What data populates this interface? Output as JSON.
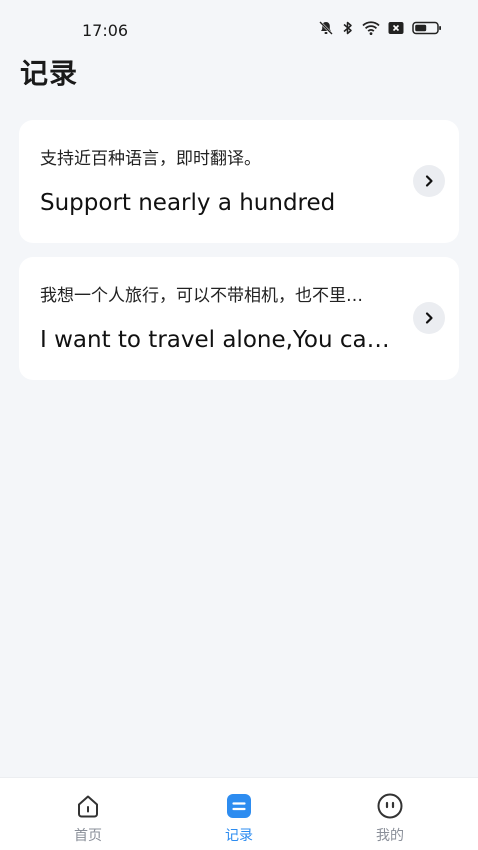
{
  "status_bar": {
    "time": "17:06",
    "icons": [
      "mute-icon",
      "bluetooth-icon",
      "wifi-icon",
      "sim-x-icon",
      "battery-icon"
    ]
  },
  "header": {
    "title": "记录"
  },
  "records": [
    {
      "source": "支持近百种语言，即时翻译。",
      "target": "Support nearly a hundred"
    },
    {
      "source": "我想一个人旅行，可以不带相机，也不里…",
      "target": "I want to travel alone,You ca…"
    }
  ],
  "tab_bar": {
    "tabs": [
      {
        "label": "首页",
        "icon": "home-icon",
        "active": false
      },
      {
        "label": "记录",
        "icon": "record-icon",
        "active": true
      },
      {
        "label": "我的",
        "icon": "profile-icon",
        "active": false
      }
    ]
  },
  "colors": {
    "background": "#F4F6F9",
    "card": "#FFFFFF",
    "accent": "#2D8CF0",
    "inactive_tab": "#8A8F99"
  }
}
